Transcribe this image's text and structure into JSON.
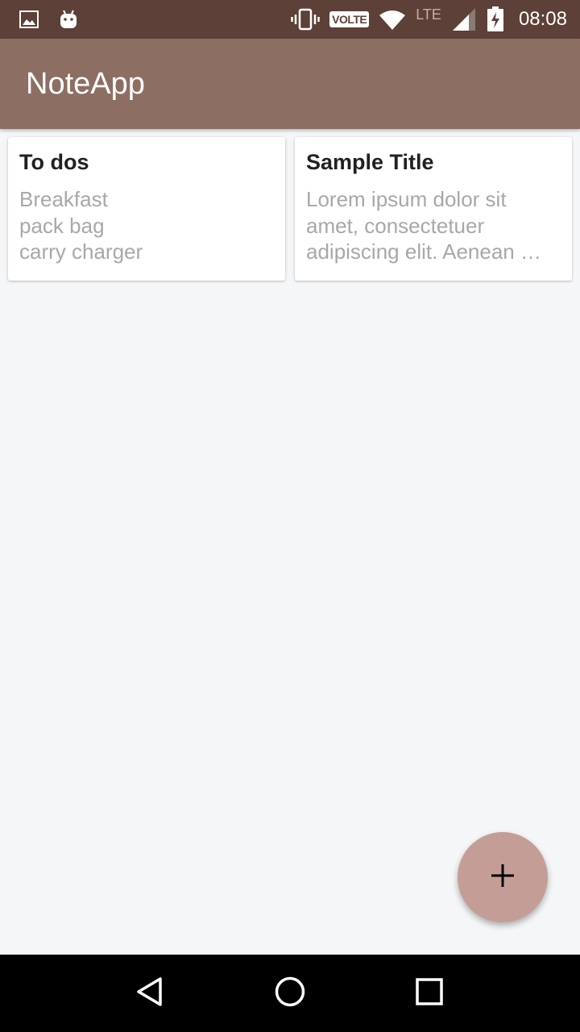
{
  "status_bar": {
    "volte_label": "VOLTE",
    "network_label": "LTE",
    "time": "08:08",
    "icons": [
      "image-icon",
      "android-icon",
      "vibrate-icon",
      "wifi-icon",
      "signal-icon",
      "battery-charging-icon"
    ]
  },
  "app_bar": {
    "title": "NoteApp",
    "color": "#8d6e63"
  },
  "notes": [
    {
      "title": "To dos",
      "lines": [
        "Breakfast",
        "pack bag",
        "carry charger"
      ]
    },
    {
      "title": "Sample Title",
      "lines": [
        "Lorem ipsum dolor sit",
        "amet, consectetuer",
        "adipiscing elit. Aenean …"
      ]
    }
  ],
  "fab": {
    "icon": "plus-icon",
    "color": "#c49e96"
  },
  "nav_bar": {
    "icons": [
      "back-icon",
      "home-icon",
      "recents-icon"
    ]
  }
}
